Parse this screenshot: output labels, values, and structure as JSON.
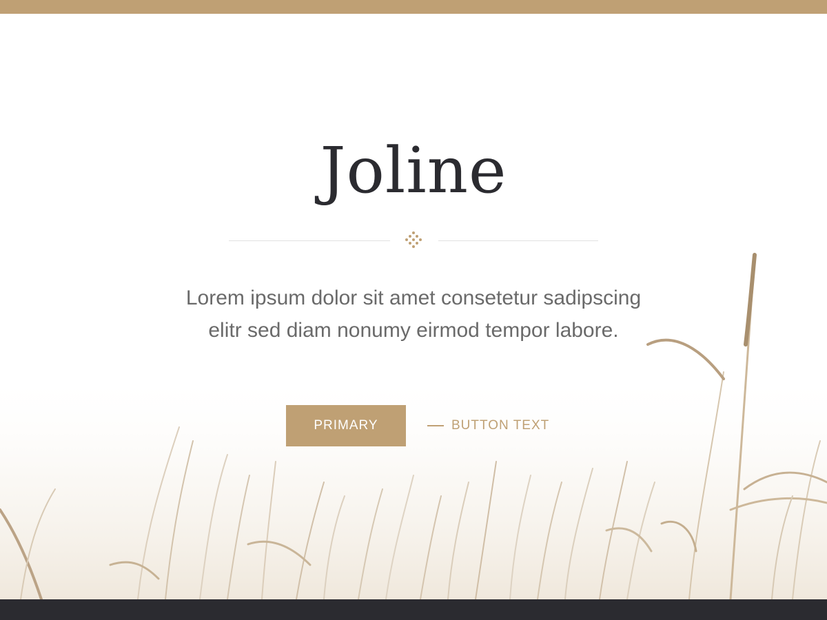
{
  "hero": {
    "title": "Joline",
    "subtitle_line1": "Lorem ipsum dolor sit amet consetetur sadipscing",
    "subtitle_line2": "elitr sed diam nonumy eirmod tempor labore."
  },
  "buttons": {
    "primary_label": "PRIMARY",
    "secondary_label": "BUTTON TEXT"
  },
  "colors": {
    "accent": "#BFA074",
    "dark": "#2B2B30",
    "text_muted": "#6A6A6A",
    "divider": "#E2E2E2"
  },
  "icons": {
    "divider_ornament": "diamond-dots-icon"
  }
}
